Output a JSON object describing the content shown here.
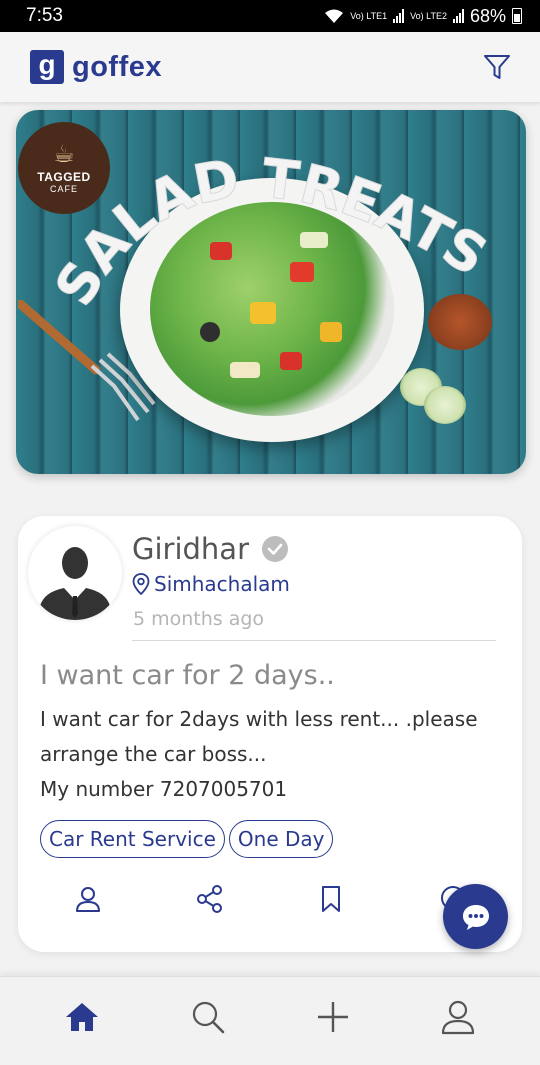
{
  "status_bar": {
    "time": "7:53",
    "sim1_label": "Vo) LTE1",
    "sim2_label": "Vo) LTE2",
    "battery": "68%"
  },
  "app_bar": {
    "logo_mark": "g",
    "logo_text": "goffex",
    "brand_color": "#2a3a8f"
  },
  "banner": {
    "cafe_name_line1": "TAGGED",
    "cafe_name_line2": "CAFE",
    "headline": "SALAD TREATS!"
  },
  "post": {
    "user_name": "Giridhar",
    "location": "Simhachalam",
    "time_ago": "5 months ago",
    "title": "I want car for 2 days..",
    "body_lines": [
      "I want car for 2days with less rent... .please",
      "arrange the car boss...",
      "My number 7207005701"
    ],
    "tags": [
      "Car Rent Service",
      "One Day"
    ],
    "actions": [
      "profile-icon",
      "share-icon",
      "bookmark-icon",
      "comment-icon"
    ]
  },
  "fab": {
    "icon": "chat-bubble-icon"
  },
  "bottom_nav": {
    "items": [
      "home-icon",
      "search-icon",
      "add-icon",
      "profile-icon"
    ],
    "active": "home-icon"
  }
}
